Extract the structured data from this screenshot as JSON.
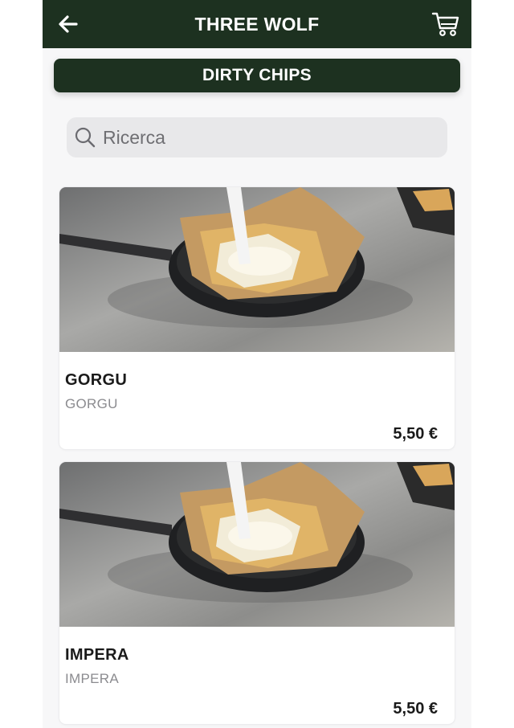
{
  "header": {
    "title": "THREE WOLF",
    "back_icon": "arrow-left-icon",
    "cart_icon": "shopping-cart-icon",
    "background_color": "#1d3120"
  },
  "category": {
    "label": "DIRTY CHIPS"
  },
  "search": {
    "placeholder": "Ricerca",
    "value": ""
  },
  "products": [
    {
      "name": "GORGU",
      "description": "GORGU",
      "price": "5,50 €",
      "image": "dirty-chips-photo"
    },
    {
      "name": "IMPERA",
      "description": "IMPERA",
      "price": "5,50 €",
      "image": "dirty-chips-photo"
    }
  ]
}
